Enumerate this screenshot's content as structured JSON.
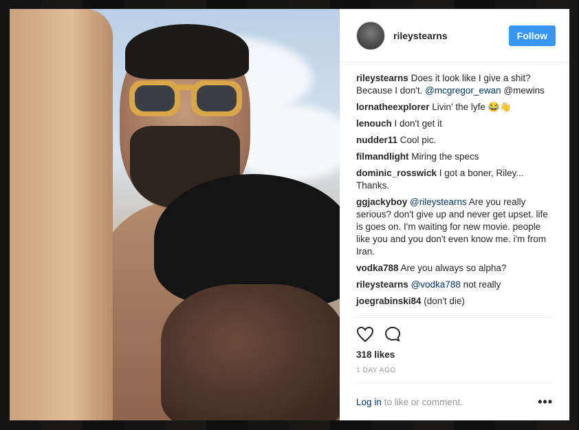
{
  "post": {
    "username": "rileystearns",
    "follow_label": "Follow"
  },
  "comments": [
    {
      "user": "rileystearns",
      "parts": [
        {
          "t": "text",
          "v": " Does it look like I give a shit? Because I don't. "
        },
        {
          "t": "mention",
          "v": "@mcgregor_ewan"
        },
        {
          "t": "text",
          "v": " @mewins"
        }
      ]
    },
    {
      "user": "lornatheexplorer",
      "parts": [
        {
          "t": "text",
          "v": " Livin' the lyfe 😂👋"
        }
      ]
    },
    {
      "user": "lenouch",
      "parts": [
        {
          "t": "text",
          "v": " I don't get it"
        }
      ]
    },
    {
      "user": "nudder11",
      "parts": [
        {
          "t": "text",
          "v": " Cool pic."
        }
      ]
    },
    {
      "user": "filmandlight",
      "parts": [
        {
          "t": "text",
          "v": " Miring the specs"
        }
      ]
    },
    {
      "user": "dominic_rosswick",
      "parts": [
        {
          "t": "text",
          "v": " I got a boner, Riley... Thanks."
        }
      ]
    },
    {
      "user": "ggjackyboy",
      "parts": [
        {
          "t": "text",
          "v": " "
        },
        {
          "t": "mention",
          "v": "@rileystearns"
        },
        {
          "t": "text",
          "v": " Are you really serious? don't give up and never get upset. life is goes on. I'm waiting for new movie. people like you and you don't even know me. i'm from Iran."
        }
      ]
    },
    {
      "user": "vodka788",
      "parts": [
        {
          "t": "text",
          "v": " Are you always so alpha?"
        }
      ]
    },
    {
      "user": "rileystearns",
      "parts": [
        {
          "t": "text",
          "v": " "
        },
        {
          "t": "mention",
          "v": "@vodka788"
        },
        {
          "t": "text",
          "v": " not really"
        }
      ]
    },
    {
      "user": "joegrabinski84",
      "parts": [
        {
          "t": "text",
          "v": " (don't die)"
        }
      ]
    }
  ],
  "actions": {
    "like_icon": "heart-icon",
    "comment_icon": "comment-bubble-icon",
    "likes_text": "318 likes",
    "timestamp": "1 DAY AGO"
  },
  "footer": {
    "login_label": "Log in",
    "rest_text": "to like or comment.",
    "more_label": "•••"
  },
  "colors": {
    "accent": "#3897f0",
    "mention": "#003569",
    "muted": "#999999"
  }
}
